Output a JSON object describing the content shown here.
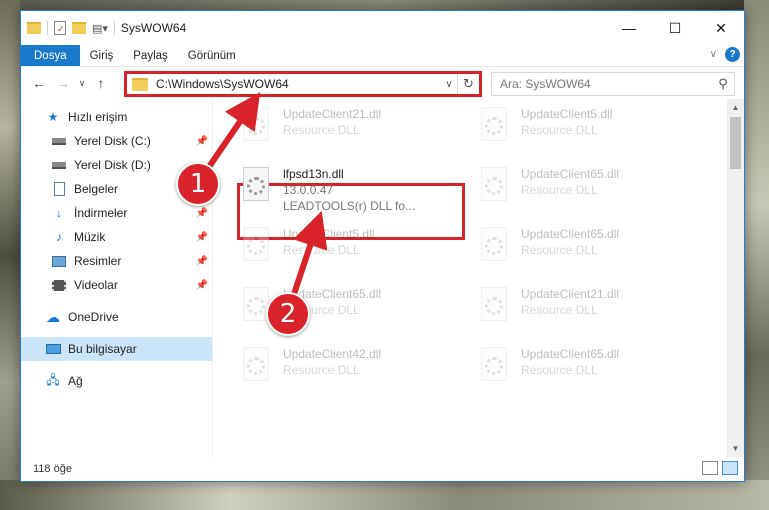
{
  "window": {
    "title": "SysWOW64",
    "controls": {
      "minimize": "—",
      "maximize": "☐",
      "close": "✕"
    }
  },
  "ribbon": {
    "tabs": [
      "Dosya",
      "Giriş",
      "Paylaş",
      "Görünüm"
    ],
    "active_tab": "Dosya",
    "help": "?"
  },
  "address": {
    "path": "C:\\Windows\\SysWOW64",
    "search_placeholder": "Ara: SysWOW64"
  },
  "nav": {
    "quick_access": "Hızlı erişim",
    "items": [
      {
        "label": "Yerel Disk (C:)",
        "icon": "drive-icon",
        "pinned": true
      },
      {
        "label": "Yerel Disk (D:)",
        "icon": "drive-icon",
        "pinned": false
      },
      {
        "label": "Belgeler",
        "icon": "documents-icon",
        "pinned": true
      },
      {
        "label": "İndirmeler",
        "icon": "downloads-icon",
        "pinned": true
      },
      {
        "label": "Müzik",
        "icon": "music-icon",
        "pinned": true
      },
      {
        "label": "Resimler",
        "icon": "pictures-icon",
        "pinned": true
      },
      {
        "label": "Videolar",
        "icon": "videos-icon",
        "pinned": true
      }
    ],
    "onedrive": "OneDrive",
    "this_pc": "Bu bilgisayar",
    "network": "Ağ"
  },
  "files": [
    {
      "name": "UpdateClient21.dll",
      "sub": "Resource DLL",
      "faded": true,
      "col": 0,
      "row": 0
    },
    {
      "name": "UpdateClient5.dll",
      "sub": "Resource DLL",
      "faded": true,
      "col": 1,
      "row": 0
    },
    {
      "name": "lfpsd13n.dll",
      "sub": "13.0.0.47",
      "sub2": "LEADTOOLS(r) DLL fo...",
      "faded": false,
      "col": 0,
      "row": 1
    },
    {
      "name": "UpdateClient65.dll",
      "sub": "Resource DLL",
      "faded": true,
      "col": 1,
      "row": 1
    },
    {
      "name": "UpdateClient5.dll",
      "sub": "Resource DLL",
      "faded": true,
      "col": 0,
      "row": 2
    },
    {
      "name": "UpdateClient65.dll",
      "sub": "Resource DLL",
      "faded": true,
      "col": 1,
      "row": 2
    },
    {
      "name": "UpdateClient65.dll",
      "sub": "Resource DLL",
      "faded": true,
      "col": 0,
      "row": 3
    },
    {
      "name": "UpdateClient21.dll",
      "sub": "Resource DLL",
      "faded": true,
      "col": 1,
      "row": 3
    },
    {
      "name": "UpdateClient42.dll",
      "sub": "Resource DLL",
      "faded": true,
      "col": 0,
      "row": 4
    },
    {
      "name": "UpdateClient65.dll",
      "sub": "Resource DLL",
      "faded": true,
      "col": 1,
      "row": 4
    }
  ],
  "status": {
    "item_count": "118 öğe"
  },
  "annotations": {
    "step1": "1",
    "step2": "2",
    "color": "#d9222a"
  }
}
